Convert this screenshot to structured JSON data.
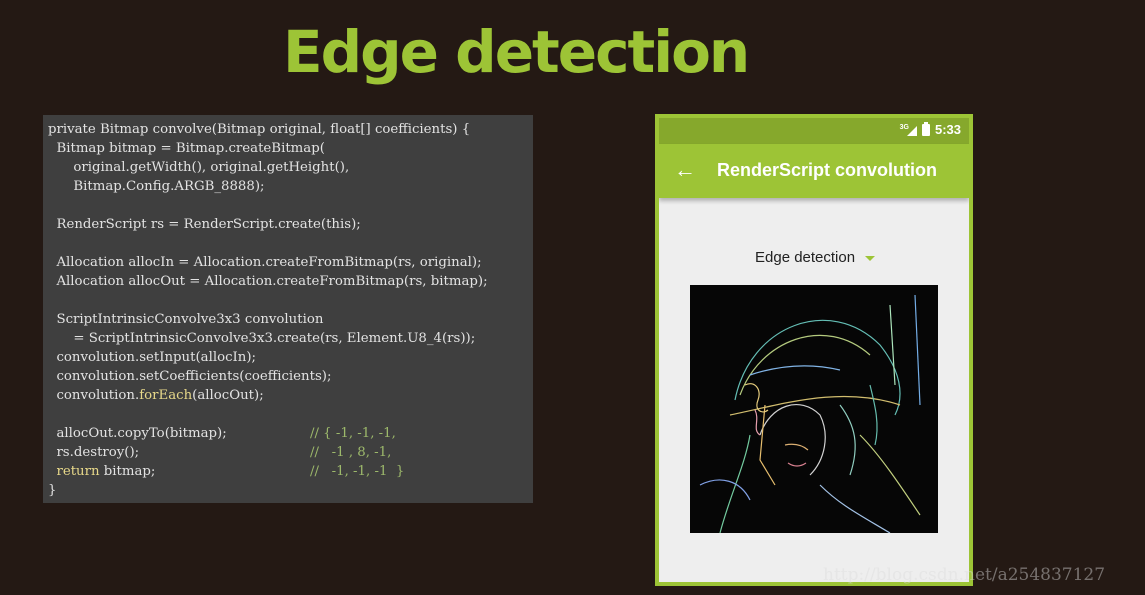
{
  "slide": {
    "title": "Edge detection"
  },
  "code": {
    "lines": [
      "private Bitmap convolve(Bitmap original, float[] coefficients) {",
      "  Bitmap bitmap = Bitmap.createBitmap(",
      "      original.getWidth(), original.getHeight(),",
      "      Bitmap.Config.ARGB_8888);",
      "",
      "  RenderScript rs = RenderScript.create(this);",
      "",
      "  Allocation allocIn = Allocation.createFromBitmap(rs, original);",
      "  Allocation allocOut = Allocation.createFromBitmap(rs, bitmap);",
      "",
      "  ScriptIntrinsicConvolve3x3 convolution",
      "      = ScriptIntrinsicConvolve3x3.create(rs, Element.U8_4(rs));",
      "  convolution.setInput(allocIn);",
      "  convolution.setCoefficients(coefficients);",
      "  convolution.",
      "",
      "  allocOut.copyTo(bitmap);",
      "  rs.destroy();",
      "  ",
      "}"
    ],
    "method_forEach": "forEach",
    "method_forEach_tail": "(allocOut);",
    "keyword_return": "return",
    "return_tail": " bitmap;",
    "comments": [
      "// { -1, -1, -1,",
      "//   -1 , 8, -1,",
      "//   -1, -1, -1  }"
    ]
  },
  "phone": {
    "status": {
      "network": "3G",
      "time": "5:33"
    },
    "toolbar": {
      "back_icon": "arrow-back-icon",
      "title": "RenderScript convolution"
    },
    "spinner": {
      "selected": "Edge detection"
    },
    "image": {
      "description_icon": "edge-detected-photo"
    }
  },
  "watermark": {
    "text": "http://blog.csdn.net/a254837127"
  },
  "colors": {
    "accent": "#9dc436",
    "status_bar": "#86a82c",
    "background": "#241914",
    "code_bg": "#3f3f3f"
  }
}
